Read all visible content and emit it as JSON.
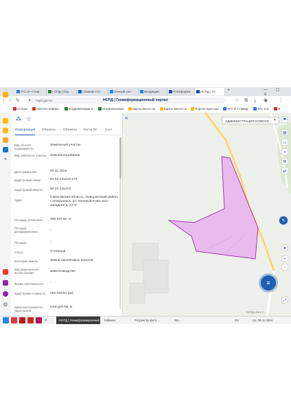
{
  "browser": {
    "tabs": [
      {
        "label": "ТГС.О • Глав",
        "color": "#3b78d8"
      },
      {
        "label": "• СПД | Код",
        "color": "#2e7d32"
      },
      {
        "label": "Главная стр",
        "color": "#1565c0"
      },
      {
        "label": "Личный кон",
        "color": "#1e88e5"
      },
      {
        "label": "Входящие",
        "color": "#1e88e5"
      },
      {
        "label": "Платформа",
        "color": "#3949ab"
      },
      {
        "label": "НСПД | Ге",
        "color": "#1f4aa5",
        "active": true
      }
    ],
    "url": "nspd.gov.ru",
    "bookmarks": [
      {
        "label": "остале",
        "color": "#d93025"
      },
      {
        "label": "Чистого поверх",
        "color": "#d93025"
      },
      {
        "label": "Геодезические а",
        "color": "#2e7d32"
      },
      {
        "label": "Геодезические",
        "color": "#2e7d32"
      },
      {
        "label": "Карты место по",
        "color": "#fbbc04"
      },
      {
        "label": "Карты место по",
        "color": "#fbbc04"
      },
      {
        "label": "Портал простые",
        "color": "#fbbc04"
      },
      {
        "label": "ТГС.О • Гамад",
        "color": "#3b78d8"
      },
      {
        "label": "ТГС 2.0",
        "color": "#3b78d8"
      },
      {
        "label": "Я",
        "color": "#d93025"
      }
    ]
  },
  "portal": {
    "title": "НСПД | Геоинформационный портал"
  },
  "panel": {
    "tabs": [
      "Информация",
      "Объекты",
      "Объекты",
      "Части ЗУ",
      "Сост"
    ],
    "rows": [
      {
        "label": "Вид объекта недвижимости",
        "value": "Земельный участок"
      },
      {
        "label": "Вид земельного участка",
        "value": "Землепользование"
      },
      {
        "label": "Дата присвоения",
        "value": "20.11.2019"
      },
      {
        "label": "Кадастровый номер",
        "value": "64:22:141410:174"
      },
      {
        "label": "Кадастровый квартал",
        "value": "64:22:141410"
      },
      {
        "label": "Адрес",
        "value": "Саратовская область, Новоузенский район, г. Новоузенск, ул. Зеленый Клин, юго-западнее д. 57\"а\""
      },
      {
        "label": "Площадь уточненная",
        "value": "400 047 кв. м"
      },
      {
        "label": "Площадь декларированная",
        "value": "-"
      },
      {
        "label": "Площадь",
        "value": "-"
      },
      {
        "label": "Статус",
        "value": "Учтенный"
      },
      {
        "label": "Категория земель",
        "value": "Земли населенных пунктов"
      },
      {
        "label": "Вид разрешенного использования",
        "value": "животноводство"
      },
      {
        "label": "Форма собственности",
        "value": "-"
      },
      {
        "label": "Кадастровая стоимость",
        "value": "252 029,61 руб."
      },
      {
        "label": "Удельный показатель кадастровой",
        "value": "0,63 руб./кв. м"
      }
    ]
  },
  "map": {
    "admin_select": "АДМИНИСТРАЦИЯ НОВОУЗ...",
    "parcel_color": "#e6a8ee",
    "scale_text": "НСПД 2024 © ...",
    "fab_icon": "list-icon"
  },
  "taskbar": {
    "active_label": "НСПД | Геоинформационный",
    "item2": "Кабинка",
    "item3": "Росреестр фото ...",
    "item4": "Wo...",
    "lang": "RU",
    "clock": "Ср, 06.11.2024"
  }
}
